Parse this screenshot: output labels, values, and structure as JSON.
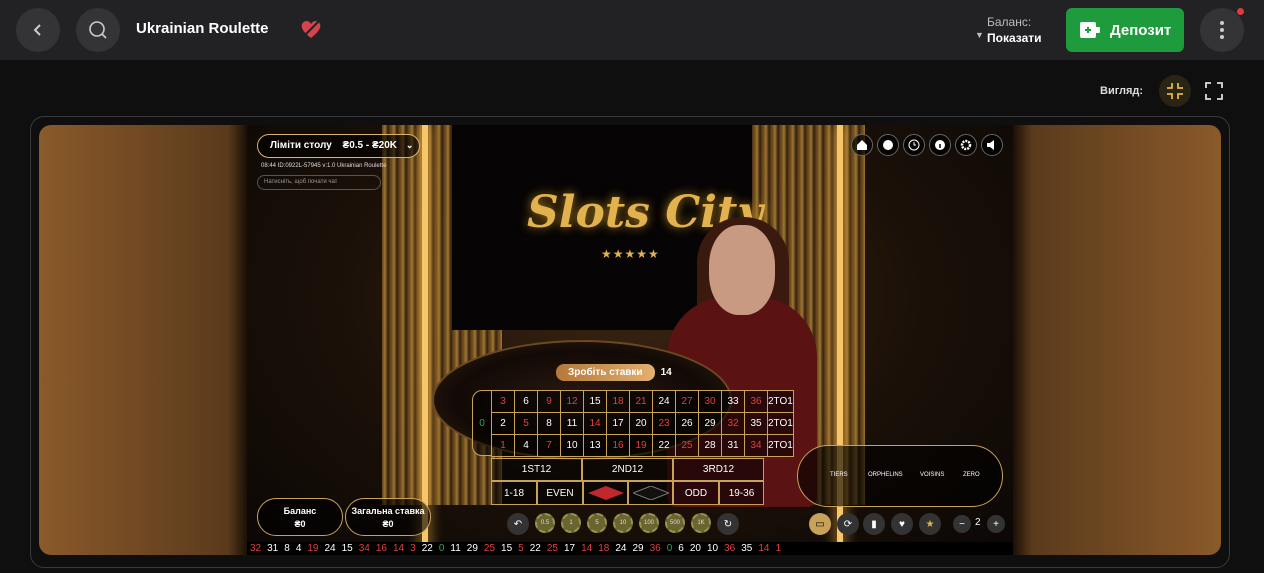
{
  "header": {
    "title": "Ukrainian Roulette",
    "balance_label": "Баланс:",
    "balance_show": "Показати",
    "deposit_label": "Депозит"
  },
  "view": {
    "label": "Вигляд:"
  },
  "game": {
    "limits_label": "Ліміти столу",
    "limits_value": "₴0.5 - ₴20K",
    "game_id": "08:44 ID:0922L-57945 v:1.0 Ukrainian Roulette",
    "chat_placeholder": "Натисніть, щоб почати чат",
    "place_bets": "Зробіть ставки",
    "countdown": "14",
    "balance_label": "Баланс",
    "balance_value": "₴0",
    "total_bet_label": "Загальна ставка",
    "total_bet_value": "₴0",
    "logo": "Slots City",
    "stars": "★★★★★",
    "zero": "0",
    "rows": [
      [
        {
          "n": "3",
          "c": "r"
        },
        {
          "n": "6",
          "c": "b"
        },
        {
          "n": "9",
          "c": "r"
        },
        {
          "n": "12",
          "c": "r"
        },
        {
          "n": "15",
          "c": "b"
        },
        {
          "n": "18",
          "c": "r"
        },
        {
          "n": "21",
          "c": "r"
        },
        {
          "n": "24",
          "c": "b"
        },
        {
          "n": "27",
          "c": "r"
        },
        {
          "n": "30",
          "c": "r"
        },
        {
          "n": "33",
          "c": "b"
        },
        {
          "n": "36",
          "c": "r"
        },
        {
          "n": "2TO1",
          "c": "b"
        }
      ],
      [
        {
          "n": "2",
          "c": "b"
        },
        {
          "n": "5",
          "c": "r"
        },
        {
          "n": "8",
          "c": "b"
        },
        {
          "n": "11",
          "c": "b"
        },
        {
          "n": "14",
          "c": "r"
        },
        {
          "n": "17",
          "c": "b"
        },
        {
          "n": "20",
          "c": "b"
        },
        {
          "n": "23",
          "c": "r"
        },
        {
          "n": "26",
          "c": "b"
        },
        {
          "n": "29",
          "c": "b"
        },
        {
          "n": "32",
          "c": "r"
        },
        {
          "n": "35",
          "c": "b"
        },
        {
          "n": "2TO1",
          "c": "b"
        }
      ],
      [
        {
          "n": "1",
          "c": "r"
        },
        {
          "n": "4",
          "c": "b"
        },
        {
          "n": "7",
          "c": "r"
        },
        {
          "n": "10",
          "c": "b"
        },
        {
          "n": "13",
          "c": "b"
        },
        {
          "n": "16",
          "c": "r"
        },
        {
          "n": "19",
          "c": "r"
        },
        {
          "n": "22",
          "c": "b"
        },
        {
          "n": "25",
          "c": "r"
        },
        {
          "n": "28",
          "c": "b"
        },
        {
          "n": "31",
          "c": "b"
        },
        {
          "n": "34",
          "c": "r"
        },
        {
          "n": "2TO1",
          "c": "b"
        }
      ]
    ],
    "dozens": [
      "1ST12",
      "2ND12",
      "3RD12"
    ],
    "outside": [
      "1-18",
      "EVEN",
      "",
      "",
      "ODD",
      "19-36"
    ],
    "race_sections": [
      "TIERS",
      "ORPHELINS",
      "VOISINS",
      "ZERO"
    ],
    "chips": [
      "0.5",
      "1",
      "5",
      "10",
      "100",
      "500",
      "1K"
    ],
    "race_count": "2",
    "history": [
      {
        "n": "32",
        "c": "r"
      },
      {
        "n": "31",
        "c": "w"
      },
      {
        "n": "8",
        "c": "w"
      },
      {
        "n": "4",
        "c": "w"
      },
      {
        "n": "19",
        "c": "r"
      },
      {
        "n": "24",
        "c": "w"
      },
      {
        "n": "15",
        "c": "w"
      },
      {
        "n": "34",
        "c": "r"
      },
      {
        "n": "16",
        "c": "r"
      },
      {
        "n": "14",
        "c": "r"
      },
      {
        "n": "3",
        "c": "r"
      },
      {
        "n": "22",
        "c": "w"
      },
      {
        "n": "0",
        "c": "g"
      },
      {
        "n": "11",
        "c": "w"
      },
      {
        "n": "29",
        "c": "w"
      },
      {
        "n": "25",
        "c": "r"
      },
      {
        "n": "15",
        "c": "w"
      },
      {
        "n": "5",
        "c": "r"
      },
      {
        "n": "22",
        "c": "w"
      },
      {
        "n": "25",
        "c": "r"
      },
      {
        "n": "17",
        "c": "w"
      },
      {
        "n": "14",
        "c": "r"
      },
      {
        "n": "18",
        "c": "r"
      },
      {
        "n": "24",
        "c": "w"
      },
      {
        "n": "29",
        "c": "w"
      },
      {
        "n": "36",
        "c": "r"
      },
      {
        "n": "0",
        "c": "g"
      },
      {
        "n": "6",
        "c": "w"
      },
      {
        "n": "20",
        "c": "w"
      },
      {
        "n": "10",
        "c": "w"
      },
      {
        "n": "36",
        "c": "r"
      },
      {
        "n": "35",
        "c": "w"
      },
      {
        "n": "14",
        "c": "r"
      },
      {
        "n": "1",
        "c": "r"
      }
    ]
  },
  "colors": {
    "accent_green": "#1e9b3c",
    "gold": "#c9a25a",
    "red": "#e14040"
  }
}
